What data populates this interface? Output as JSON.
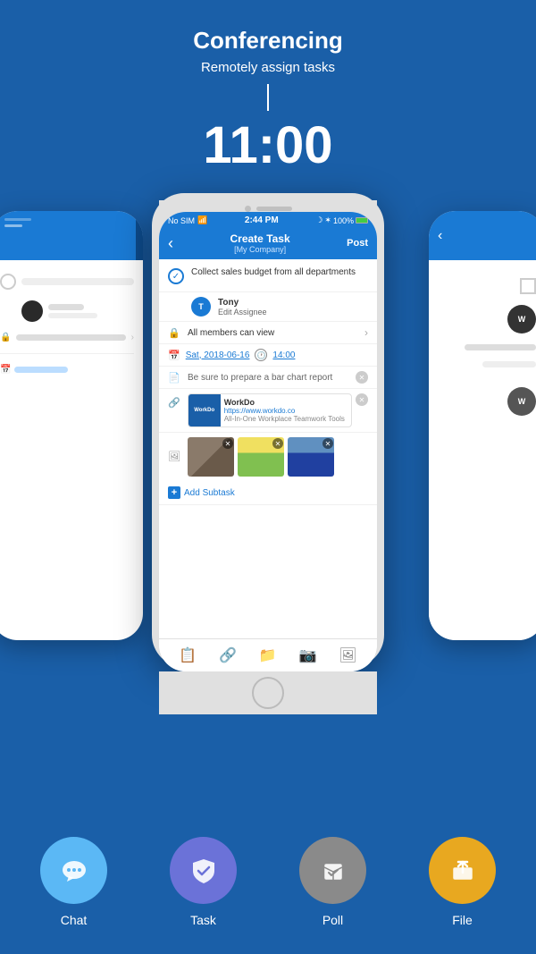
{
  "header": {
    "title": "Conferencing",
    "subtitle": "Remotely assign tasks"
  },
  "time": "11:00",
  "phone_center": {
    "status_bar": {
      "carrier": "No SIM",
      "wifi": "wifi",
      "time": "2:44 PM",
      "moon": "☽",
      "bluetooth": "✶",
      "battery": "100%"
    },
    "nav": {
      "back": "‹",
      "title": "Create Task",
      "company": "[My Company]",
      "action": "Post"
    },
    "task": {
      "description": "Collect sales budget from all departments",
      "assignee_name": "Tony",
      "assignee_action": "Edit Assignee",
      "privacy": "All members can view",
      "date": "Sat, 2018-06-16",
      "time": "14:00",
      "note": "Be sure to prepare a bar chart report",
      "link_title": "WorkDo",
      "link_url": "https://www.workdo.co",
      "link_desc": "All-In-One Workplace Teamwork Tools",
      "add_subtask": "Add Subtask"
    },
    "toolbar": {
      "icons": [
        "📋",
        "🔗",
        "📁",
        "📷",
        "🖼"
      ]
    }
  },
  "features": [
    {
      "id": "chat",
      "label": "Chat",
      "color": "#5bb8f5"
    },
    {
      "id": "task",
      "label": "Task",
      "color": "#6b72d8"
    },
    {
      "id": "poll",
      "label": "Poll",
      "color": "#8a8a8a"
    },
    {
      "id": "file",
      "label": "File",
      "color": "#e8a820"
    }
  ]
}
